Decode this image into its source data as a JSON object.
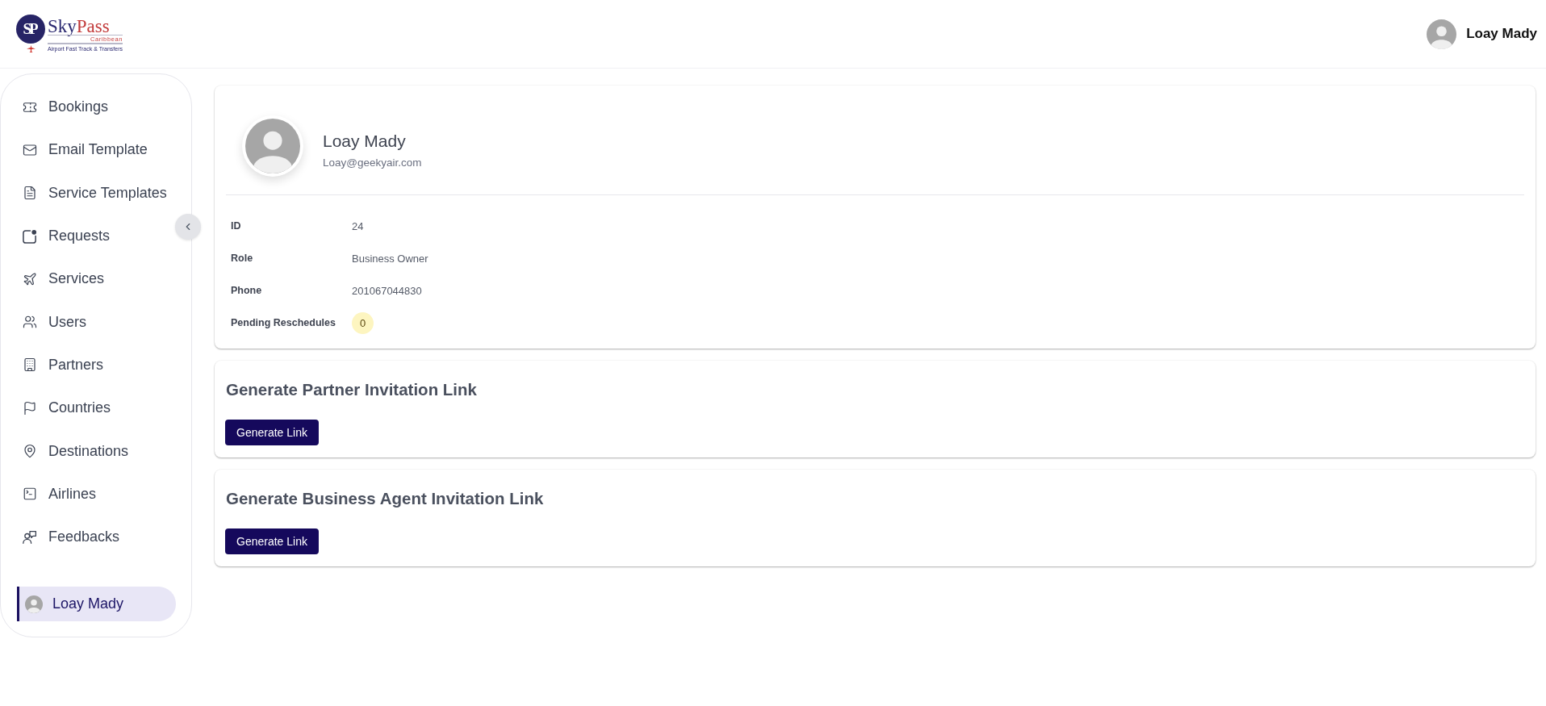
{
  "header": {
    "logo": {
      "monogram": "SP",
      "wordmark": [
        "Sky",
        "Pass"
      ],
      "region": "Caribbean",
      "tagline": "Airport Fast Track & Transfers"
    },
    "user": {
      "name": "Loay Mady"
    }
  },
  "sidebar": {
    "items": [
      {
        "label": "Bookings",
        "selected": false
      },
      {
        "label": "Email Template",
        "selected": false
      },
      {
        "label": "Service Templates",
        "selected": false
      },
      {
        "label": "Requests",
        "selected": false
      },
      {
        "label": "Services",
        "selected": false
      },
      {
        "label": "Users",
        "selected": false
      },
      {
        "label": "Partners",
        "selected": false
      },
      {
        "label": "Countries",
        "selected": false
      },
      {
        "label": "Destinations",
        "selected": false
      },
      {
        "label": "Airlines",
        "selected": false
      },
      {
        "label": "Feedbacks",
        "selected": false
      }
    ],
    "profile": {
      "name": "Loay Mady",
      "selected": true
    }
  },
  "profile": {
    "name": "Loay Mady",
    "email": "Loay@geekyair.com",
    "fields": [
      {
        "label": "ID",
        "value": "24",
        "kind": "text"
      },
      {
        "label": "Role",
        "value": "Business Owner",
        "kind": "text"
      },
      {
        "label": "Phone",
        "value": "201067044830",
        "kind": "text"
      },
      {
        "label": "Pending Reschedules",
        "value": "0",
        "kind": "badge"
      }
    ]
  },
  "invitations": [
    {
      "title": "Generate Partner Invitation Link",
      "button": "Generate Link"
    },
    {
      "title": "Generate Business Agent Invitation Link",
      "button": "Generate Link"
    }
  ]
}
